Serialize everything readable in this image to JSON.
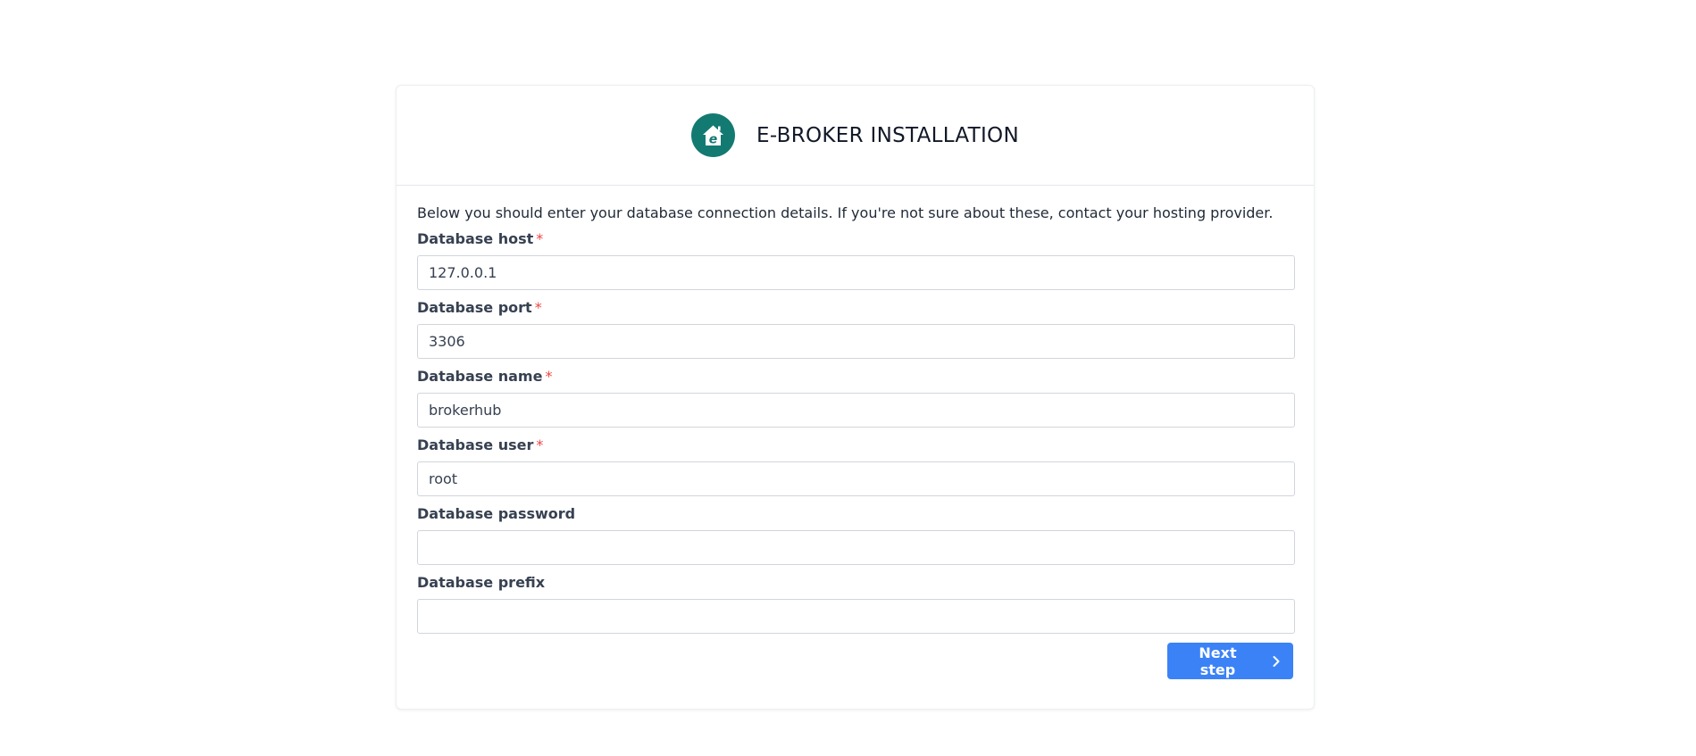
{
  "colors": {
    "brand": "#137a72",
    "primary_button": "#3b82f6",
    "required_star": "#ef4444"
  },
  "header": {
    "logo_icon": "house-e-logo-icon",
    "title": "E-BROKER INSTALLATION"
  },
  "intro_text": "Below you should enter your database connection details. If you're not sure about these, contact your hosting provider.",
  "fields": [
    {
      "label": "Database host",
      "required": true,
      "value": "127.0.0.1"
    },
    {
      "label": "Database port",
      "required": true,
      "value": "3306"
    },
    {
      "label": "Database name",
      "required": true,
      "value": "brokerhub"
    },
    {
      "label": "Database user",
      "required": true,
      "value": "root"
    },
    {
      "label": "Database password",
      "required": false,
      "value": ""
    },
    {
      "label": "Database prefix",
      "required": false,
      "value": ""
    }
  ],
  "required_marker": "*",
  "next_button": {
    "label": "Next step",
    "icon": "chevron-right-icon"
  }
}
